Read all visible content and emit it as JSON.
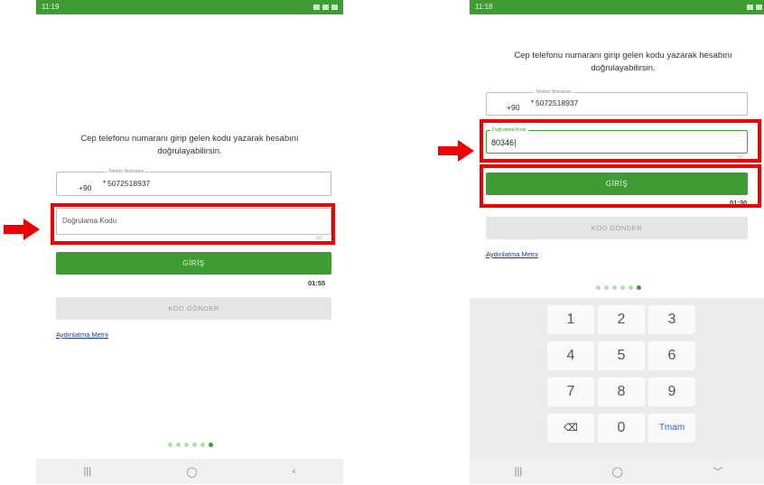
{
  "left": {
    "status_time": "11:19",
    "message": "Cep telefonu numaranı girip gelen kodu yazarak hesabını doğrulayabilirsin.",
    "phone_field_legend": "Telefon Numarası",
    "country_code": "+90",
    "phone_number": "5072518937",
    "code_placeholder": "Doğrulama Kodu",
    "code_counter": "0/3",
    "login_button": "GİRİŞ",
    "timer": "01:55",
    "send_code_button": "KOD GÖNDER",
    "privacy_link": "Aydınlatma Metni",
    "page_dots": 6,
    "active_dot": 6,
    "nav_recent": "|||",
    "nav_home": "◯",
    "nav_back": "‹"
  },
  "right": {
    "status_time": "11:18",
    "message": "Cep telefonu numaranı girip gelen kodu yazarak hesabını doğrulayabilirsin.",
    "phone_field_legend": "Telefon Numarası",
    "country_code": "+90",
    "phone_number": "5072518937",
    "code_legend": "Doğrulama Kodu",
    "code_value": "80346",
    "code_counter": "5/5",
    "login_button": "GİRİŞ",
    "timer": "01:30",
    "send_code_button": "KOD GÖNDER",
    "privacy_link": "Aydınlatma Metni",
    "page_dots": 6,
    "active_dot": 6,
    "keys": [
      "1",
      "2",
      "3",
      "4",
      "5",
      "6",
      "7",
      "8",
      "9",
      "⌫",
      "0",
      "Tmam"
    ],
    "nav_recent": "|||",
    "nav_home": "◯",
    "nav_back": "﹀"
  },
  "colors": {
    "accent": "#3f9c35",
    "highlight": "#ee0000",
    "link": "#1a3d8f"
  }
}
